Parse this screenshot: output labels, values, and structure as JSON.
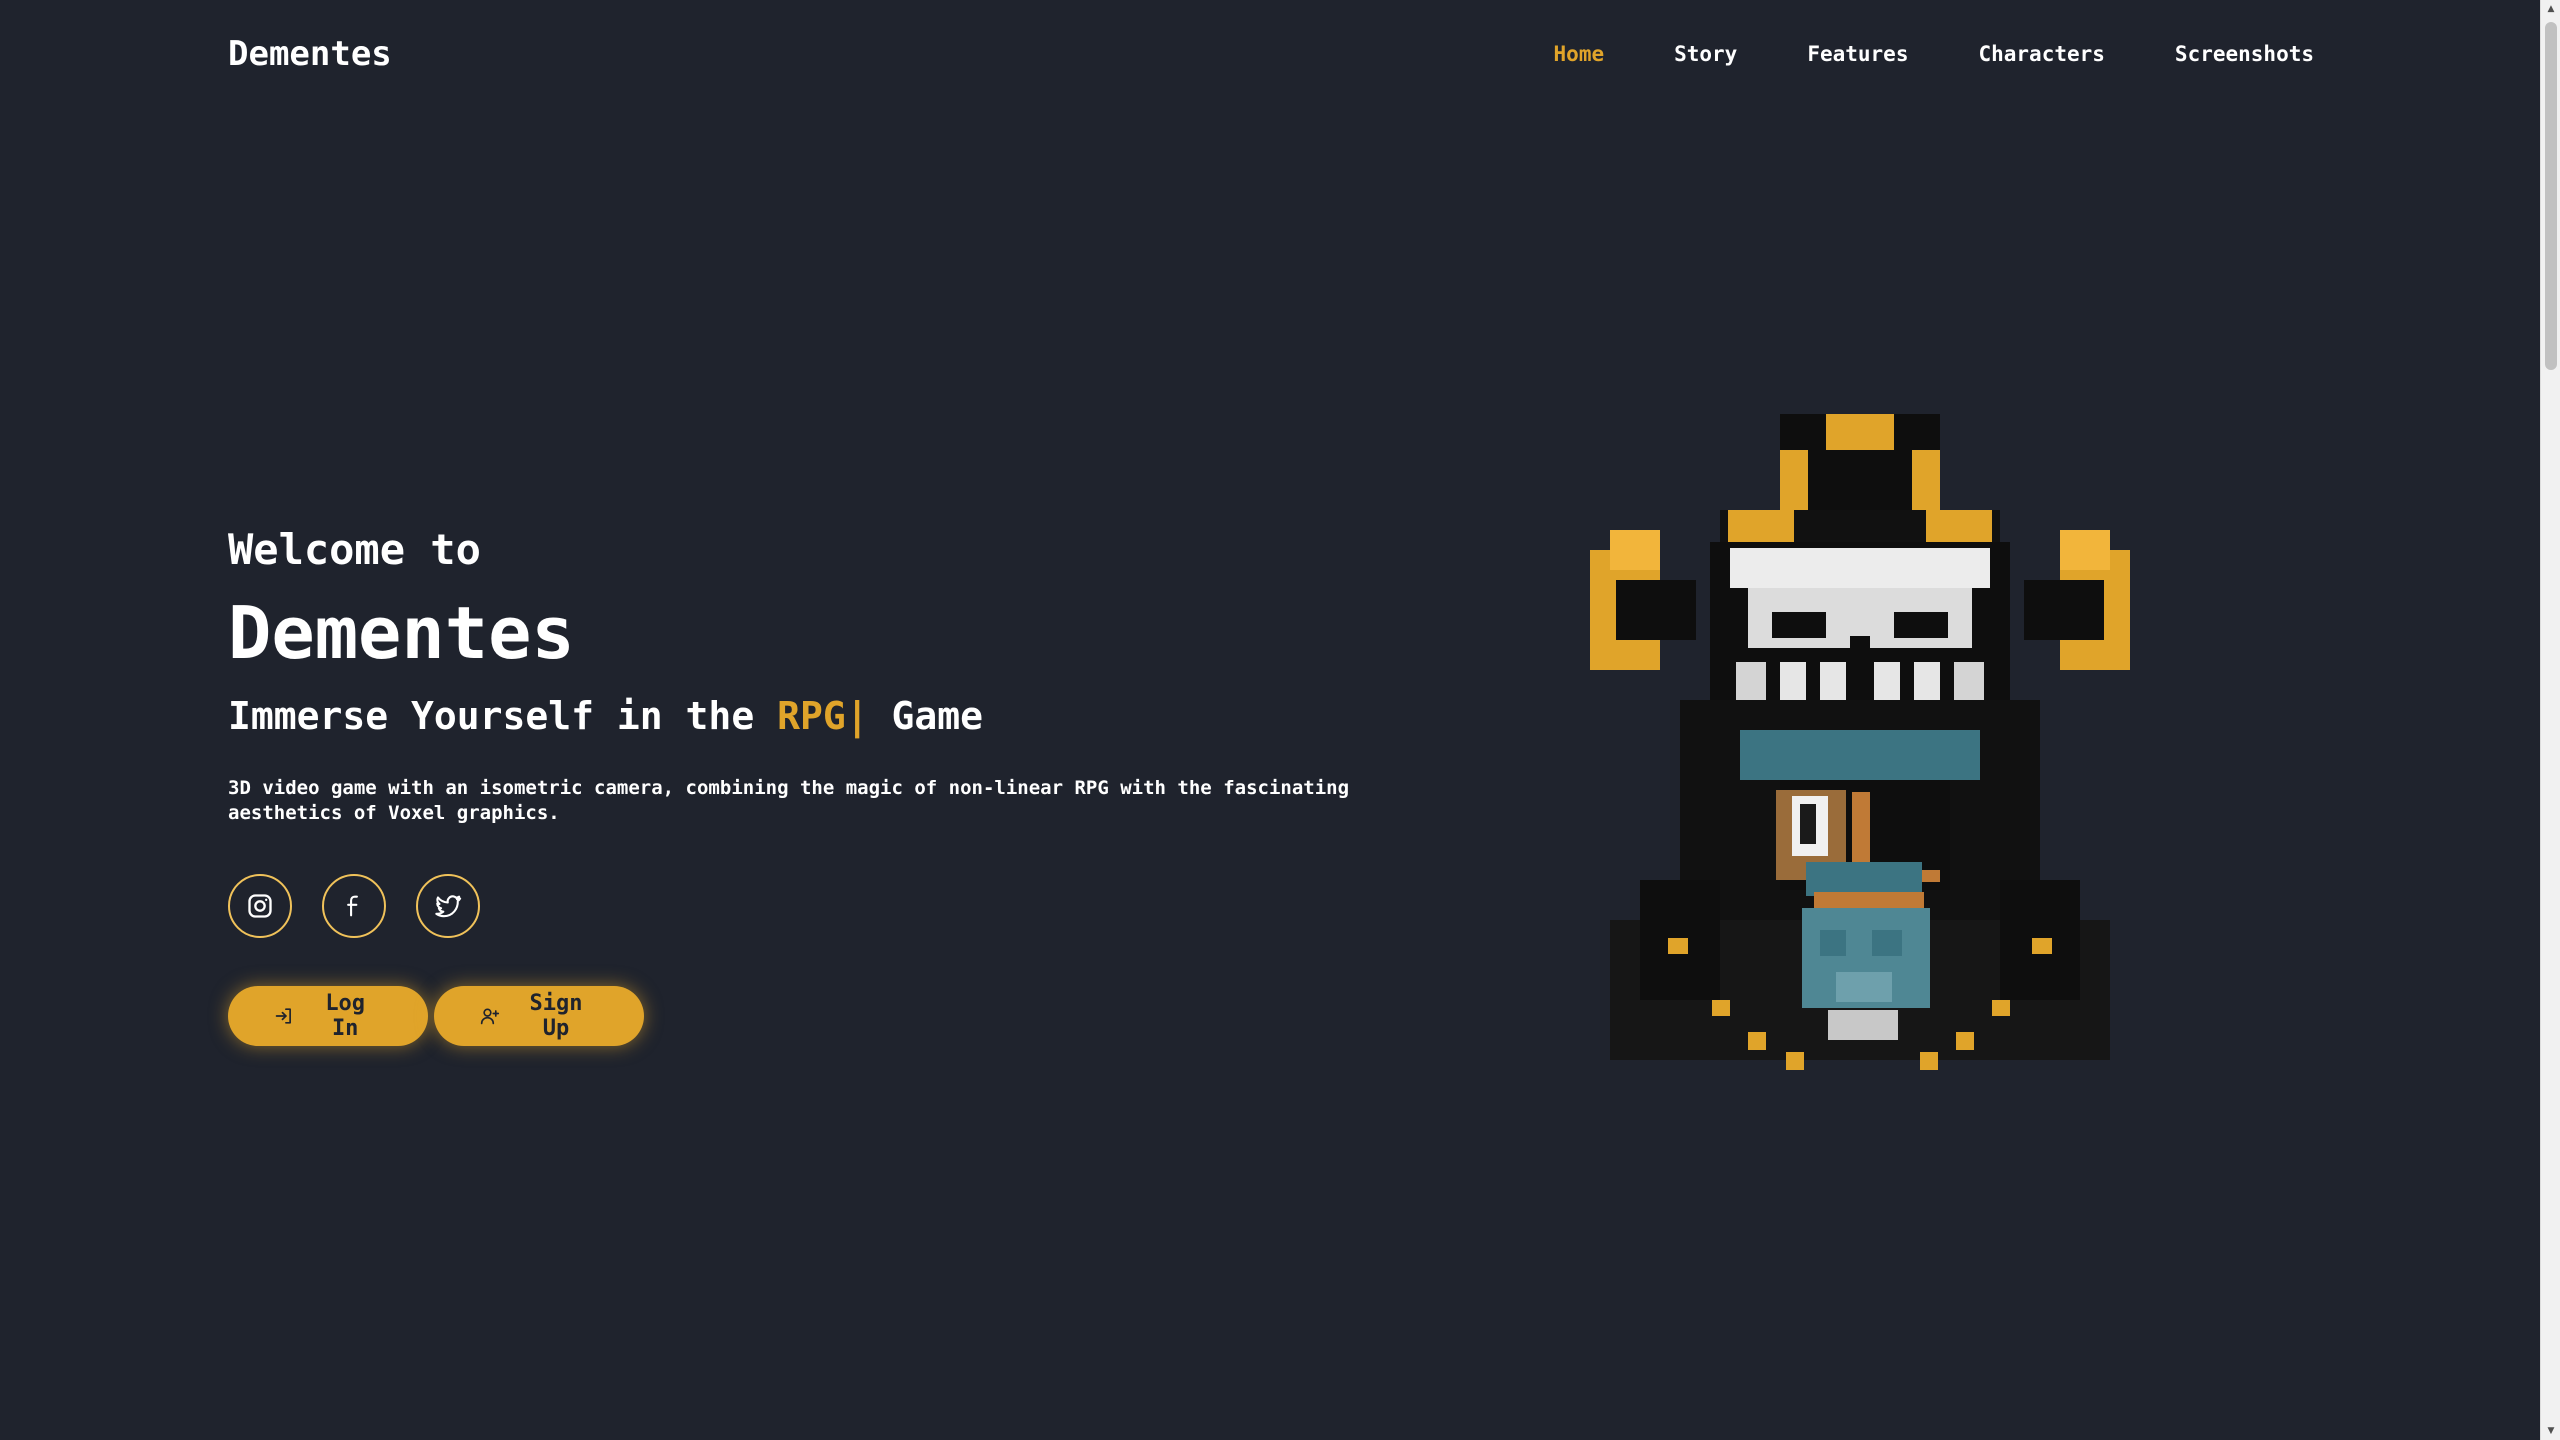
{
  "brand": "Dementes",
  "nav": {
    "items": [
      {
        "label": "Home",
        "active": true
      },
      {
        "label": "Story",
        "active": false
      },
      {
        "label": "Features",
        "active": false
      },
      {
        "label": "Characters",
        "active": false
      },
      {
        "label": "Screenshots",
        "active": false
      }
    ]
  },
  "hero": {
    "welcome": "Welcome to",
    "title": "Dementes",
    "tagline_prefix": "Immerse Yourself in the",
    "tagline_highlight": "RPG",
    "tagline_cursor": "|",
    "tagline_suffix": "Game",
    "description": "3D video game with an isometric camera, combining the magic of non-linear RPG with the fascinating aesthetics of Voxel graphics."
  },
  "socials": [
    {
      "icon": "instagram-icon"
    },
    {
      "icon": "facebook-icon"
    },
    {
      "icon": "twitter-icon"
    }
  ],
  "buttons": {
    "login_label": "Log In",
    "signup_label": "Sign Up"
  },
  "colors": {
    "background": "#1f232d",
    "accent": "#e0a42a",
    "text": "#ffffff"
  }
}
